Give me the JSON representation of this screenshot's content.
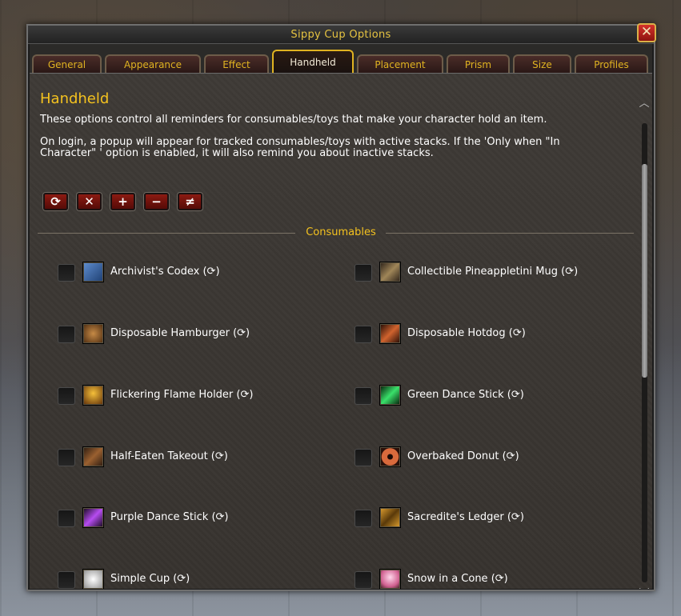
{
  "window": {
    "title": "Sippy Cup Options",
    "close_glyph": "✕"
  },
  "tabs": [
    {
      "label": "General"
    },
    {
      "label": "Appearance"
    },
    {
      "label": "Effect"
    },
    {
      "label": "Handheld",
      "active": true
    },
    {
      "label": "Placement"
    },
    {
      "label": "Prism"
    },
    {
      "label": "Size"
    },
    {
      "label": "Profiles"
    }
  ],
  "panel": {
    "heading": "Handheld",
    "desc1": "These options control all reminders for consumables/toys that make your character hold an item.",
    "desc2": "On login, a popup will appear for tracked consumables/toys with active stacks. If the 'Only when \"In Character\" ' option is enabled, it will also remind you about inactive stacks.",
    "action_buttons": [
      {
        "icon": "refresh-icon",
        "glyph": "⟳"
      },
      {
        "icon": "close-icon",
        "glyph": "✕"
      },
      {
        "icon": "plus-icon",
        "glyph": "+"
      },
      {
        "icon": "minus-icon",
        "glyph": "−"
      },
      {
        "icon": "not-equal-icon",
        "glyph": "≠"
      }
    ],
    "section_label": "Consumables",
    "items": [
      {
        "label": "Archivist's Codex (⟳)",
        "icon": "book-icon",
        "color": "#3f6aa8"
      },
      {
        "label": "Collectible Pineappletini Mug (⟳)",
        "icon": "mug-icon",
        "color": "#6b5a3a"
      },
      {
        "label": "Disposable Hamburger (⟳)",
        "icon": "hamburger-icon",
        "color": "#8a5b2a"
      },
      {
        "label": "Disposable Hotdog (⟳)",
        "icon": "hotdog-icon",
        "color": "#a84a24"
      },
      {
        "label": "Flickering Flame Holder (⟳)",
        "icon": "flame-holder-icon",
        "color": "#7a4a14"
      },
      {
        "label": "Green Dance Stick (⟳)",
        "icon": "green-stick-icon",
        "color": "#1f8a3a"
      },
      {
        "label": "Half-Eaten Takeout (⟳)",
        "icon": "takeout-icon",
        "color": "#6a4020"
      },
      {
        "label": "Overbaked Donut (⟳)",
        "icon": "donut-icon",
        "color": "#b0502a"
      },
      {
        "label": "Purple Dance Stick (⟳)",
        "icon": "purple-stick-icon",
        "color": "#6a2a9a"
      },
      {
        "label": "Sacredite's Ledger (⟳)",
        "icon": "ledger-icon",
        "color": "#9a6a1a"
      },
      {
        "label": "Simple Cup (⟳)",
        "icon": "cup-icon",
        "color": "#d8d8d8"
      },
      {
        "label": "Snow in a Cone (⟳)",
        "icon": "snow-cone-icon",
        "color": "#e28ab0"
      }
    ]
  },
  "colors": {
    "accent": "#f4c21f",
    "tab_text": "#e0b321",
    "text": "#ffffff",
    "button_red": "#8c1a12"
  }
}
